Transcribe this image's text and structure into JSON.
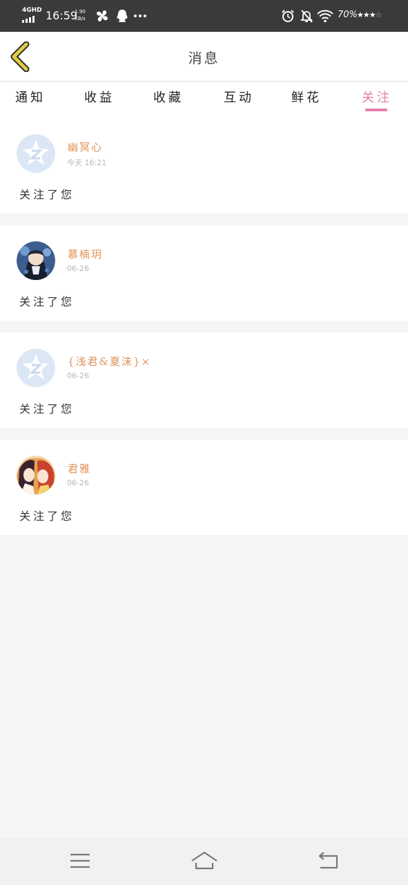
{
  "status_bar": {
    "network": "4GHD",
    "time": "16:59",
    "speed_value": "1.90",
    "speed_unit": "KB/s",
    "battery": "70%",
    "icons": [
      "fan-icon",
      "qq-icon",
      "more-dots-icon",
      "alarm-icon",
      "mute-bell-icon",
      "wifi-icon",
      "star-rating-icon"
    ]
  },
  "header": {
    "title": "消息",
    "back_icon": "chevron-left-icon"
  },
  "tabs": [
    {
      "label": "通知",
      "active": false
    },
    {
      "label": "收益",
      "active": false
    },
    {
      "label": "收藏",
      "active": false
    },
    {
      "label": "互动",
      "active": false
    },
    {
      "label": "鲜花",
      "active": false
    },
    {
      "label": "关注",
      "active": true
    }
  ],
  "messages": [
    {
      "username": "幽冥心",
      "time": "今天 16:21",
      "text": "关注了您",
      "avatar": "default-qzone-avatar"
    },
    {
      "username": "慕楠玥",
      "time": "06-26",
      "text": "关注了您",
      "avatar": "anime-avatar"
    },
    {
      "username": "{浅君&夏沫}×",
      "time": "06-26",
      "text": "关注了您",
      "avatar": "default-qzone-avatar"
    },
    {
      "username": "君雅",
      "time": "06-26",
      "text": "关注了您",
      "avatar": "anime-avatar"
    }
  ],
  "colors": {
    "accent": "#e57ea8",
    "username": "#e0935a",
    "back_icon": "#d9c43a",
    "status_bar": "#3a3a3a"
  },
  "nav": [
    "menu-icon",
    "home-icon",
    "back-icon"
  ]
}
